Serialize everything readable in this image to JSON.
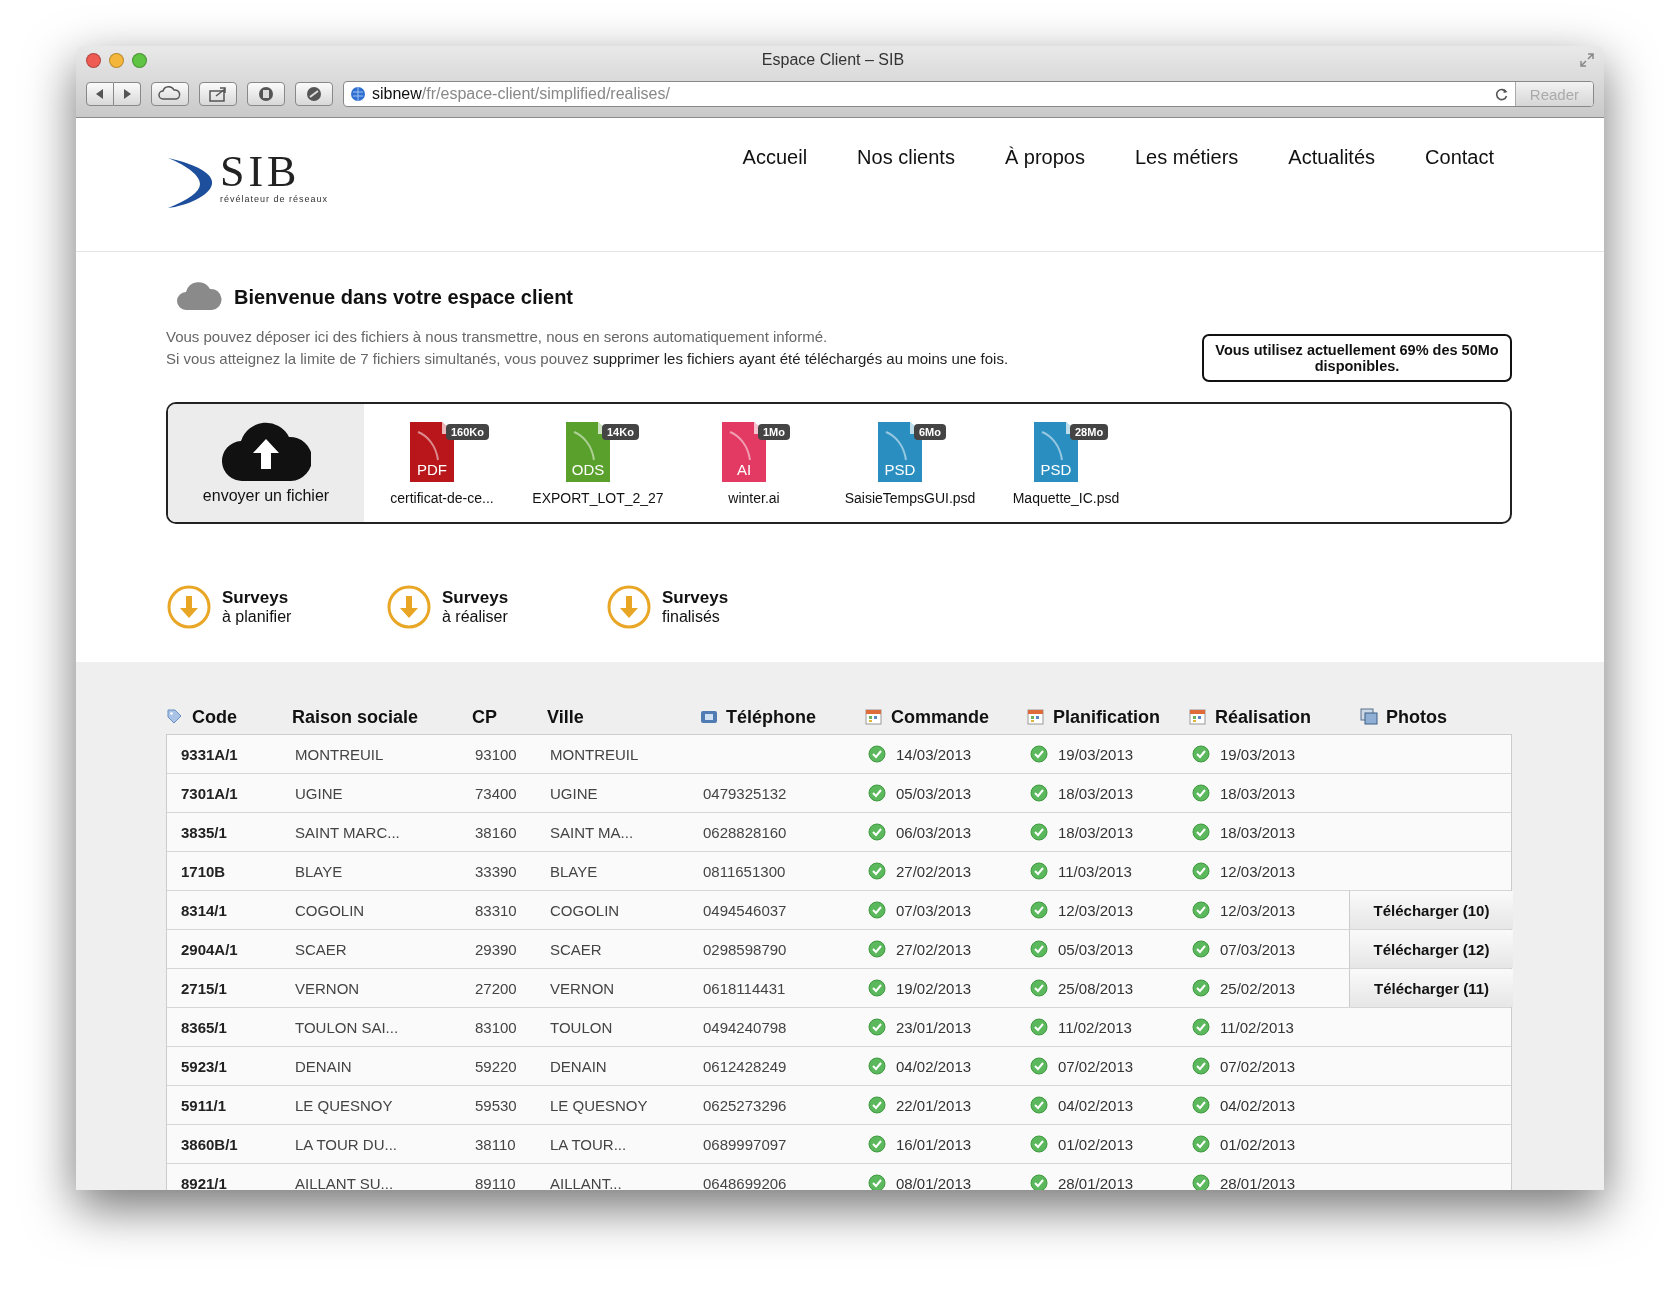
{
  "window": {
    "title": "Espace Client – SIB"
  },
  "address_bar": {
    "host": "sibnew",
    "path": "/fr/espace-client/simplified/realises/"
  },
  "reader_button": {
    "label": "Reader",
    "disabled": true
  },
  "logo": {
    "name": "SIB",
    "tagline": "révélateur de réseaux"
  },
  "nav": [
    {
      "label": "Accueil"
    },
    {
      "label": "Nos clients"
    },
    {
      "label": "À propos"
    },
    {
      "label": "Les métiers"
    },
    {
      "label": "Actualités"
    },
    {
      "label": "Contact"
    }
  ],
  "welcome": {
    "title": "Bienvenue dans votre espace client",
    "line_1": "Vous pouvez déposer ici des fichiers à nous transmettre, nous en serons automatiquement informé.",
    "line_2": "Si vous atteignez la limite de 7 fichiers simultanés, vous pouvez",
    "line_2_link": "supprimer les fichiers ayant été téléchargés au moins une fois.",
    "usage": "Vous utilisez actuellement 69% des 50Mo disponibles."
  },
  "upload": {
    "label": "envoyer un fichier"
  },
  "files": [
    {
      "kind": "pdf",
      "badge": "PDF",
      "size": "160Ko",
      "name": "certificat-de-ce..."
    },
    {
      "kind": "ods",
      "badge": "ODS",
      "size": "14Ko",
      "name": "EXPORT_LOT_2_27"
    },
    {
      "kind": "ai",
      "badge": "AI",
      "size": "1Mo",
      "name": "winter.ai"
    },
    {
      "kind": "psd",
      "badge": "PSD",
      "size": "6Mo",
      "name": "SaisieTempsGUI.psd"
    },
    {
      "kind": "psd",
      "badge": "PSD",
      "size": "28Mo",
      "name": "Maquette_IC.psd"
    }
  ],
  "surveys": [
    {
      "title": "Surveys",
      "subtitle": "à planifier"
    },
    {
      "title": "Surveys",
      "subtitle": "à réaliser"
    },
    {
      "title": "Surveys",
      "subtitle": "finalisés"
    }
  ],
  "table": {
    "columns": [
      {
        "label": "Code",
        "kind": "tag"
      },
      {
        "label": "Raison sociale",
        "kind": "plain"
      },
      {
        "label": "CP",
        "kind": "plain"
      },
      {
        "label": "Ville",
        "kind": "plain"
      },
      {
        "label": "Téléphone",
        "kind": "phone"
      },
      {
        "label": "Commande",
        "kind": "calendar"
      },
      {
        "label": "Planification",
        "kind": "calendar"
      },
      {
        "label": "Réalisation",
        "kind": "calendar"
      },
      {
        "label": "Photos",
        "kind": "photos"
      }
    ],
    "rows": [
      {
        "code": "9331A/1",
        "name": "MONTREUIL",
        "cp": "93100",
        "city": "MONTREUIL",
        "order": "14/03/2013",
        "planned": "19/03/2013",
        "done": "19/03/2013"
      },
      {
        "code": "7301A/1",
        "name": "UGINE",
        "cp": "73400",
        "city": "UGINE",
        "phone": "0479325132",
        "order": "05/03/2013",
        "planned": "18/03/2013",
        "done": "18/03/2013"
      },
      {
        "code": "3835/1",
        "name": "SAINT MARC...",
        "cp": "38160",
        "city": "SAINT MA...",
        "phone": "0628828160",
        "order": "06/03/2013",
        "planned": "18/03/2013",
        "done": "18/03/2013"
      },
      {
        "code": "1710B",
        "name": "BLAYE",
        "cp": "33390",
        "city": "BLAYE",
        "phone": "0811651300",
        "order": "27/02/2013",
        "planned": "11/03/2013",
        "done": "12/03/2013"
      },
      {
        "code": "8314/1",
        "name": "COGOLIN",
        "cp": "83310",
        "city": "COGOLIN",
        "phone": "0494546037",
        "order": "07/03/2013",
        "planned": "12/03/2013",
        "done": "12/03/2013",
        "photos": "Télécharger (10)"
      },
      {
        "code": "2904A/1",
        "name": "SCAER",
        "cp": "29390",
        "city": "SCAER",
        "phone": "0298598790",
        "order": "27/02/2013",
        "planned": "05/03/2013",
        "done": "07/03/2013",
        "photos": "Télécharger (12)"
      },
      {
        "code": "2715/1",
        "name": "VERNON",
        "cp": "27200",
        "city": "VERNON",
        "phone": "0618114431",
        "order": "19/02/2013",
        "planned": "25/08/2013",
        "done": "25/02/2013",
        "photos": "Télécharger (11)"
      },
      {
        "code": "8365/1",
        "name": "TOULON SAI...",
        "cp": "83100",
        "city": "TOULON",
        "phone": "0494240798",
        "order": "23/01/2013",
        "planned": "11/02/2013",
        "done": "11/02/2013"
      },
      {
        "code": "5923/1",
        "name": "DENAIN",
        "cp": "59220",
        "city": "DENAIN",
        "phone": "0612428249",
        "order": "04/02/2013",
        "planned": "07/02/2013",
        "done": "07/02/2013"
      },
      {
        "code": "5911/1",
        "name": "LE QUESNOY",
        "cp": "59530",
        "city": "LE QUESNOY",
        "phone": "0625273296",
        "order": "22/01/2013",
        "planned": "04/02/2013",
        "done": "04/02/2013"
      },
      {
        "code": "3860B/1",
        "name": "LA TOUR DU...",
        "cp": "38110",
        "city": "LA TOUR...",
        "phone": "0689997097",
        "order": "16/01/2013",
        "planned": "01/02/2013",
        "done": "01/02/2013"
      },
      {
        "code": "8921/1",
        "name": "AILLANT SU...",
        "cp": "89110",
        "city": "AILLANT...",
        "phone": "0648699206",
        "order": "08/01/2013",
        "planned": "28/01/2013",
        "done": "28/01/2013"
      }
    ]
  }
}
